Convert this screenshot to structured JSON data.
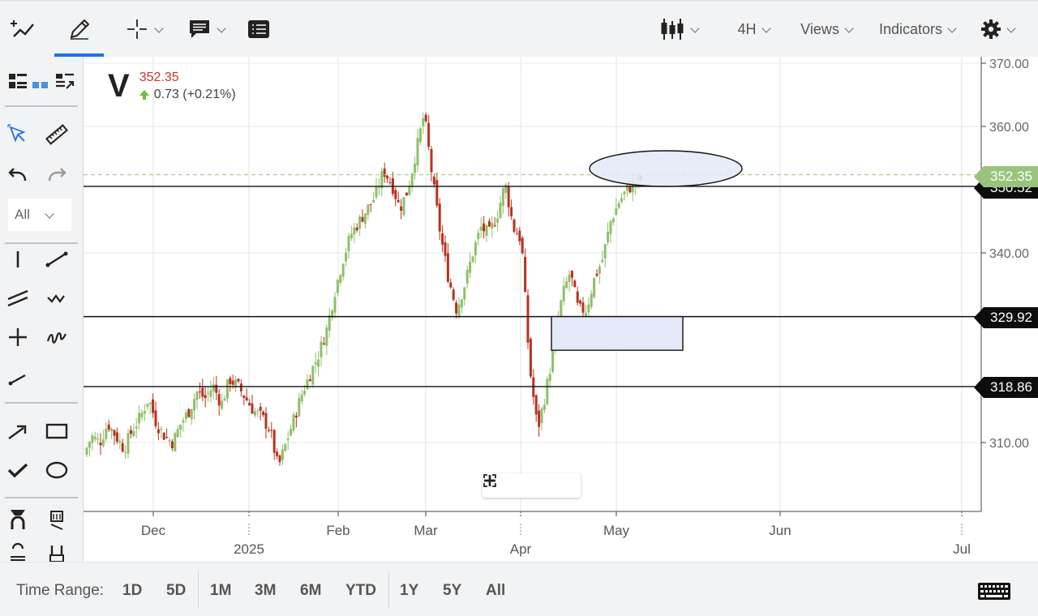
{
  "toolbar": {
    "interval": "4H",
    "views": "Views",
    "indicators": "Indicators"
  },
  "sidebar": {
    "filter_value": "All"
  },
  "quote": {
    "symbol": "V",
    "last": "352.35",
    "change": "0.73 (+0.21%)"
  },
  "yaxis": {
    "ticks": [
      "370.00",
      "360.00",
      "340.00",
      "310.00"
    ]
  },
  "xaxis": {
    "months": [
      "Dec",
      "Feb",
      "Mar",
      "May",
      "Jun"
    ],
    "years": [
      "2025",
      "Apr",
      "Jul"
    ]
  },
  "price_tags": {
    "current": "352.35",
    "h1": "350.52",
    "h2": "329.92",
    "h3": "318.86"
  },
  "bottom": {
    "time_range_label": "Time Range:",
    "ranges": [
      "1D",
      "5D",
      "1M",
      "3M",
      "6M",
      "YTD",
      "1Y",
      "5Y",
      "All"
    ]
  },
  "colors": {
    "up": "#8fbf6a",
    "down": "#b8321f",
    "accent": "#1a73e8",
    "current_price": "#98c47c",
    "zone_fill": "#e4e9f7"
  }
}
